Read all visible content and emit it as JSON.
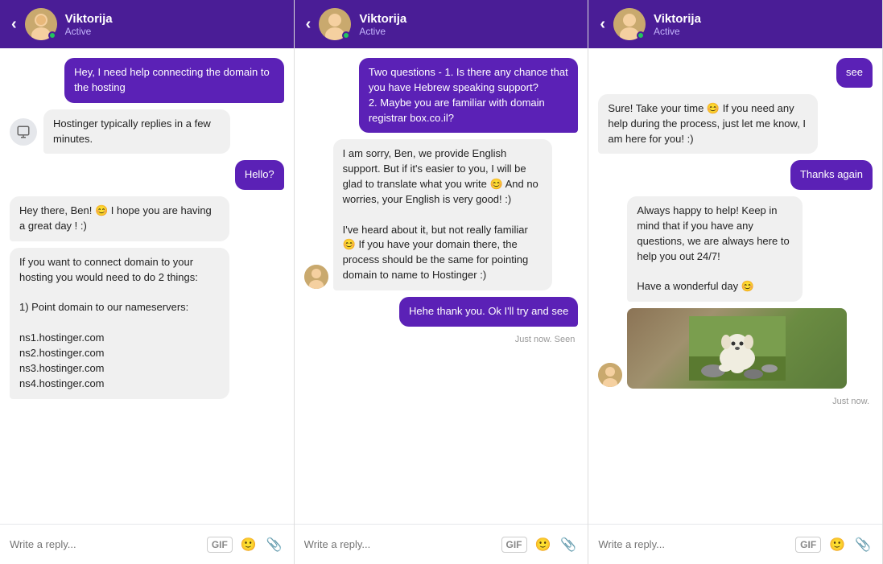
{
  "panels": [
    {
      "id": "panel1",
      "header": {
        "back_label": "‹",
        "name": "Viktorija",
        "status": "Active"
      },
      "messages": [
        {
          "id": "m1",
          "type": "out",
          "text": "Hey, I need help connecting the domain to the hosting"
        },
        {
          "id": "m2",
          "type": "in-icon",
          "text": "Hostinger typically replies in a few minutes."
        },
        {
          "id": "m3",
          "type": "out",
          "text": "Hello?"
        },
        {
          "id": "m4",
          "type": "in",
          "text": "Hey there, Ben! 😊 I hope you are having a great day ! :)"
        },
        {
          "id": "m5",
          "type": "in",
          "text": "If you want to connect domain to your hosting you would need to do 2 things:\n\n1) Point domain to our nameservers:\n\nns1.hostinger.com\nns2.hostinger.com\nns3.hostinger.com\nns4.hostinger.com"
        }
      ],
      "footer": {
        "placeholder": "Write a reply...",
        "gif_label": "GIF"
      }
    },
    {
      "id": "panel2",
      "header": {
        "back_label": "‹",
        "name": "Viktorija",
        "status": "Active"
      },
      "messages": [
        {
          "id": "m1",
          "type": "out",
          "text": "Two questions - 1. Is there any chance that you have Hebrew speaking support?\n2. Maybe you are familiar with domain registrar box.co.il?"
        },
        {
          "id": "m2",
          "type": "in-avatar",
          "text": "I am sorry, Ben, we provide English support. But if it's easier to you, I will be glad to translate what you write 😊 And no worries, your English is very good! :)\n\nI've heard about it, but not really familiar 😊 If you have your domain there, the process should be the same for pointing domain to name to Hostinger :)"
        },
        {
          "id": "m3",
          "type": "out",
          "text": "Hehe thank you. Ok I'll try and see"
        },
        {
          "id": "m4",
          "type": "timestamp",
          "text": "Just now. Seen"
        }
      ],
      "footer": {
        "placeholder": "Write a reply...",
        "gif_label": "GIF"
      }
    },
    {
      "id": "panel3",
      "header": {
        "back_label": "‹",
        "name": "Viktorija",
        "status": "Active"
      },
      "messages": [
        {
          "id": "m0",
          "type": "out-partial",
          "text": "see"
        },
        {
          "id": "m1",
          "type": "in-long",
          "text": "Sure! Take your time 😊 If you need any help during the process, just let me know, I am here for you! :)"
        },
        {
          "id": "m2",
          "type": "out",
          "text": "Thanks again"
        },
        {
          "id": "m3",
          "type": "in-dog",
          "text": "Always happy to help! Keep in mind that if you have any questions, we are always here to help you out 24/7!\n\nHave a wonderful day 😊"
        },
        {
          "id": "m4",
          "type": "timestamp",
          "text": "Just now."
        }
      ],
      "footer": {
        "placeholder": "Write a reply...",
        "gif_label": "GIF"
      }
    }
  ]
}
